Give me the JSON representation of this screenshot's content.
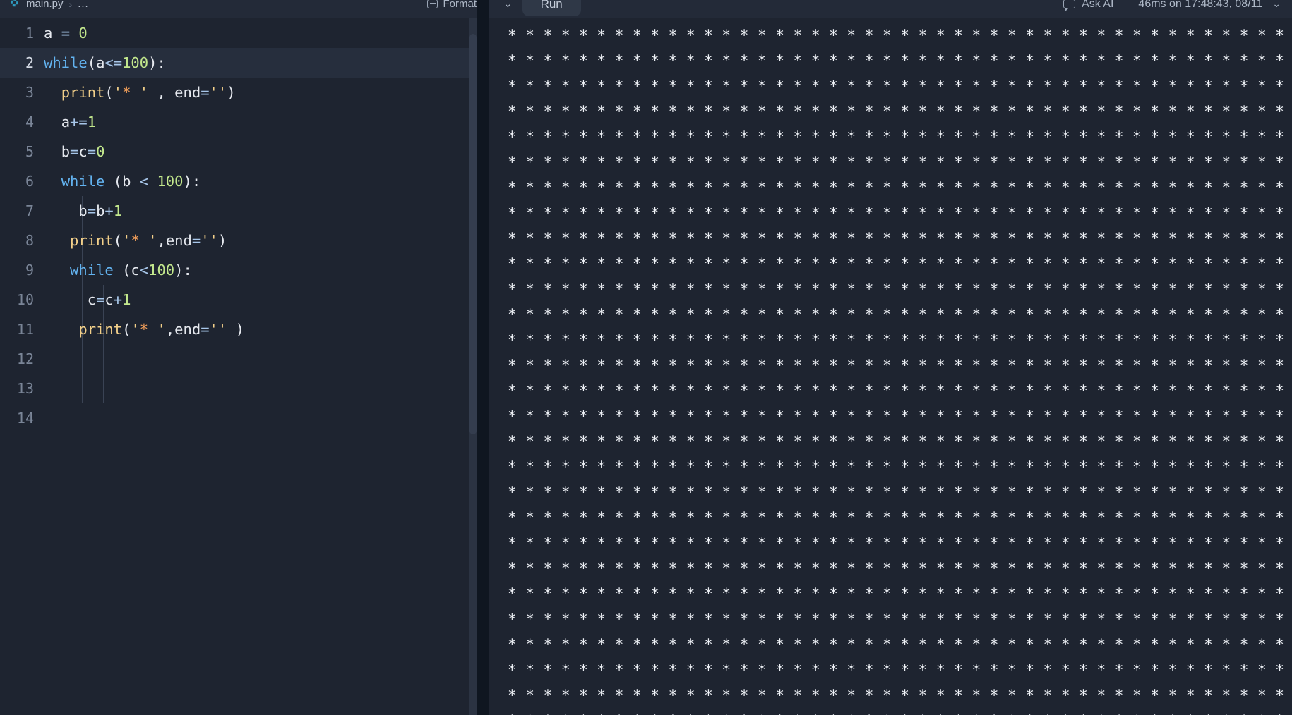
{
  "editor": {
    "breadcrumb": {
      "file": "main.py",
      "separator": "›",
      "more": "..."
    },
    "format_label": "Format",
    "icon_names": {
      "file": "python-file-icon",
      "format": "format-icon"
    },
    "lines": [
      {
        "n": "1",
        "tokens": [
          {
            "t": "a ",
            "c": "pl"
          },
          {
            "t": "= ",
            "c": "op"
          },
          {
            "t": "0",
            "c": "num"
          }
        ],
        "indent": 0
      },
      {
        "n": "2",
        "tokens": [
          {
            "t": "while",
            "c": "kw"
          },
          {
            "t": "(",
            "c": "pl"
          },
          {
            "t": "a",
            "c": "pl"
          },
          {
            "t": "<=",
            "c": "op"
          },
          {
            "t": "100",
            "c": "num"
          },
          {
            "t": "):",
            "c": "pl"
          }
        ],
        "indent": 0
      },
      {
        "n": "3",
        "tokens": [
          {
            "t": "  ",
            "c": "pl"
          },
          {
            "t": "print",
            "c": "fn"
          },
          {
            "t": "(",
            "c": "pl"
          },
          {
            "t": "'",
            "c": "str"
          },
          {
            "t": "*",
            "c": "star"
          },
          {
            "t": " '",
            "c": "str"
          },
          {
            "t": " , ",
            "c": "pl"
          },
          {
            "t": "end",
            "c": "pl"
          },
          {
            "t": "=",
            "c": "op"
          },
          {
            "t": "''",
            "c": "str"
          },
          {
            "t": ")",
            "c": "pl"
          }
        ],
        "indent": 1
      },
      {
        "n": "4",
        "tokens": [
          {
            "t": "  ",
            "c": "pl"
          },
          {
            "t": "a",
            "c": "pl"
          },
          {
            "t": "+=",
            "c": "op"
          },
          {
            "t": "1",
            "c": "num"
          }
        ],
        "indent": 1
      },
      {
        "n": "5",
        "tokens": [
          {
            "t": "  ",
            "c": "pl"
          },
          {
            "t": "b",
            "c": "pl"
          },
          {
            "t": "=",
            "c": "op"
          },
          {
            "t": "c",
            "c": "pl"
          },
          {
            "t": "=",
            "c": "op"
          },
          {
            "t": "0",
            "c": "num"
          }
        ],
        "indent": 1
      },
      {
        "n": "6",
        "tokens": [
          {
            "t": "  ",
            "c": "pl"
          },
          {
            "t": "while",
            "c": "kw"
          },
          {
            "t": " (b ",
            "c": "pl"
          },
          {
            "t": "<",
            "c": "op"
          },
          {
            "t": " ",
            "c": "pl"
          },
          {
            "t": "100",
            "c": "num"
          },
          {
            "t": "):",
            "c": "pl"
          }
        ],
        "indent": 1
      },
      {
        "n": "7",
        "tokens": [
          {
            "t": "    ",
            "c": "pl"
          },
          {
            "t": "b",
            "c": "pl"
          },
          {
            "t": "=",
            "c": "op"
          },
          {
            "t": "b",
            "c": "pl"
          },
          {
            "t": "+",
            "c": "op"
          },
          {
            "t": "1",
            "c": "num"
          }
        ],
        "indent": 2
      },
      {
        "n": "8",
        "tokens": [
          {
            "t": "   ",
            "c": "pl"
          },
          {
            "t": "print",
            "c": "fn"
          },
          {
            "t": "(",
            "c": "pl"
          },
          {
            "t": "'",
            "c": "str"
          },
          {
            "t": "*",
            "c": "star"
          },
          {
            "t": " '",
            "c": "str"
          },
          {
            "t": ",",
            "c": "pl"
          },
          {
            "t": "end",
            "c": "pl"
          },
          {
            "t": "=",
            "c": "op"
          },
          {
            "t": "''",
            "c": "str"
          },
          {
            "t": ")",
            "c": "pl"
          }
        ],
        "indent": 2
      },
      {
        "n": "9",
        "tokens": [
          {
            "t": "   ",
            "c": "pl"
          },
          {
            "t": "while",
            "c": "kw"
          },
          {
            "t": " (c",
            "c": "pl"
          },
          {
            "t": "<",
            "c": "op"
          },
          {
            "t": "100",
            "c": "num"
          },
          {
            "t": "):",
            "c": "pl"
          }
        ],
        "indent": 2
      },
      {
        "n": "10",
        "tokens": [
          {
            "t": "     ",
            "c": "pl"
          },
          {
            "t": "c",
            "c": "pl"
          },
          {
            "t": "=",
            "c": "op"
          },
          {
            "t": "c",
            "c": "pl"
          },
          {
            "t": "+",
            "c": "op"
          },
          {
            "t": "1",
            "c": "num"
          }
        ],
        "indent": 3
      },
      {
        "n": "11",
        "tokens": [
          {
            "t": "    ",
            "c": "pl"
          },
          {
            "t": "print",
            "c": "fn"
          },
          {
            "t": "(",
            "c": "pl"
          },
          {
            "t": "'",
            "c": "str"
          },
          {
            "t": "*",
            "c": "star"
          },
          {
            "t": " '",
            "c": "str"
          },
          {
            "t": ",",
            "c": "pl"
          },
          {
            "t": "end",
            "c": "pl"
          },
          {
            "t": "=",
            "c": "op"
          },
          {
            "t": "''",
            "c": "str"
          },
          {
            "t": " )",
            "c": "pl"
          }
        ],
        "indent": 3
      },
      {
        "n": "12",
        "tokens": [],
        "indent": 3
      },
      {
        "n": "13",
        "tokens": [],
        "indent": 3
      },
      {
        "n": "14",
        "tokens": [],
        "indent": 0
      }
    ],
    "active_line": "2"
  },
  "output": {
    "collapse_chevron": "⌄",
    "run_label": "Run",
    "ask_ai_label": "Ask AI",
    "ask_ai_icon": "speech-bubble-icon",
    "timing_label": "46ms on 17:48:43, 08/11",
    "timing_chevron": "⌄",
    "console_unit": "* ",
    "console_repeat": 1540
  },
  "colors": {
    "editor_bg": "#1e2430",
    "topbar_bg": "#232a38",
    "active_line_bg": "#262e3d",
    "keyword": "#63b3f0",
    "number": "#c3e88d",
    "function": "#f3d08a",
    "string": "#f3d08a",
    "asterisk": "#f5a05a",
    "operator": "#a8c7ea",
    "plain": "#e6e9ef",
    "gutter": "#7a8597",
    "divider": "#0f1620"
  }
}
